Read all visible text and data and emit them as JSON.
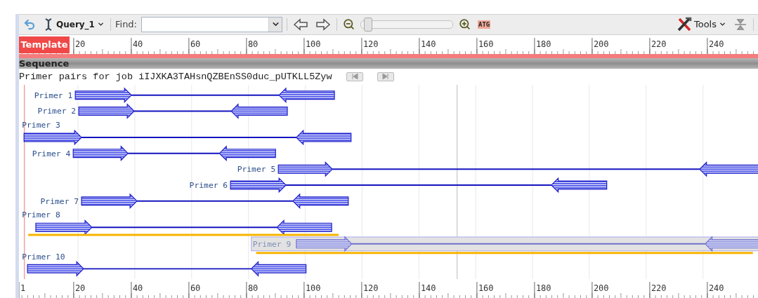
{
  "toolbar": {
    "query": "Query_1",
    "find_label": "Find:",
    "zoom": {
      "level": 0.03
    },
    "atg": "ATG",
    "tools": "Tools"
  },
  "ruler_top": {
    "label": "Template",
    "ticks": [
      "20",
      "40",
      "60",
      "80",
      "100",
      "120",
      "140",
      "160",
      "180",
      "200",
      "220",
      "240"
    ]
  },
  "track": "Sequence",
  "job_title": "Primer pairs for job iIJXKA3TAHsnQZBEnSS0duc_pUTKLL5Zyw",
  "primers": [
    {
      "label": "Primer 1",
      "selected": false,
      "marked": false
    },
    {
      "label": "Primer 2",
      "selected": false,
      "marked": false
    },
    {
      "label": "Primer 3",
      "selected": false,
      "marked": false
    },
    {
      "label": "Primer 4",
      "selected": false,
      "marked": false
    },
    {
      "label": "Primer 5",
      "selected": false,
      "marked": false
    },
    {
      "label": "Primer 6",
      "selected": false,
      "marked": false
    },
    {
      "label": "Primer 7",
      "selected": false,
      "marked": false
    },
    {
      "label": "Primer 8",
      "selected": false,
      "marked": true
    },
    {
      "label": "Primer 9",
      "selected": true,
      "marked": true
    },
    {
      "label": "Primer 10",
      "selected": false,
      "marked": false
    }
  ],
  "ruler_bottom": {
    "ticks": [
      "1",
      "20",
      "40",
      "60",
      "80",
      "100",
      "120",
      "140",
      "160",
      "180",
      "200",
      "220",
      "240"
    ]
  }
}
